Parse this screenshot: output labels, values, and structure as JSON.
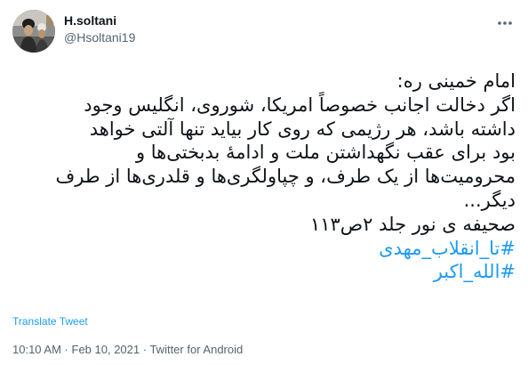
{
  "author": {
    "display_name": "H.soltani",
    "handle": "@Hsoltani19"
  },
  "tweet": {
    "lines": [
      "امام خمینی ره:",
      "اگر دخالت اجانب خصوصاً امریکا، شوروی، انگلیس وجود",
      "داشته باشد، هر رژیمی که روی کار بیاید تنها آلتی خواهد",
      "بود برای عقب نگهداشتن ملت و ادامهٔ بدبختی‌ها و",
      "محرومیت‌ها از یک طرف، و چپاولگری‌ها و قلدری‌ها از طرف",
      "دیگر...",
      "صحیفه ی نور جلد ۲ص۱۱۳"
    ],
    "hashtags": [
      "#تا_انقلاب_مهدی",
      "#الله_اکبر"
    ],
    "translate_label": "Translate Tweet"
  },
  "meta": {
    "time": "10:10 AM",
    "separator1": " · ",
    "date": "Feb 10, 2021",
    "separator2": " · ",
    "source": "Twitter for Android"
  },
  "icons": {
    "more": "more-icon",
    "avatar": "avatar"
  }
}
